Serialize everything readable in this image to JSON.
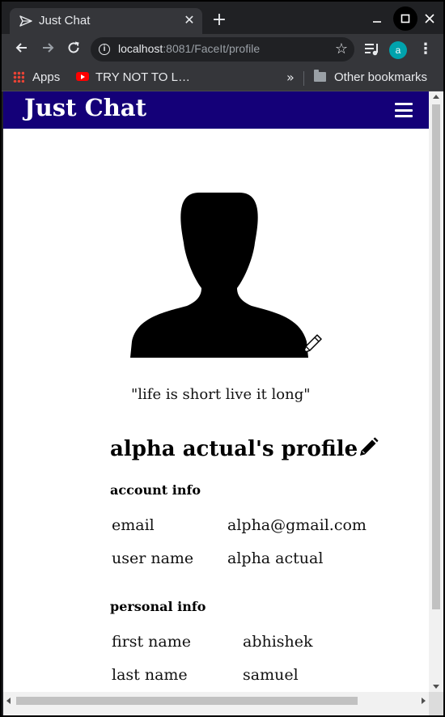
{
  "browser": {
    "tab_title": "Just Chat",
    "tab_close": "✕",
    "new_tab": "+",
    "url_host": "localhost",
    "url_path": ":8081/FaceIt/profile",
    "profile_initial": "a",
    "icons": {
      "tab": "send-arrow-icon",
      "back": "arrow-left-icon",
      "forward": "arrow-right-icon",
      "reload": "reload-icon",
      "info": "info-icon",
      "star": "star-icon",
      "media": "media-queue-icon",
      "menu": "three-dots-icon",
      "folder": "folder-icon"
    },
    "accent": "#00a3ad"
  },
  "bookmarks": {
    "apps": "Apps",
    "youtube": "TRY NOT TO L…",
    "overflow": "»",
    "other": "Other bookmarks"
  },
  "app": {
    "brand": "Just Chat",
    "navbar_color": "#140078"
  },
  "profile": {
    "status_quote": "\"life is short live it long\"",
    "title": "alpha actual's profile",
    "account": {
      "heading": "account info",
      "rows": [
        {
          "label": "email",
          "value": "alpha@gmail.com"
        },
        {
          "label": "user name",
          "value": "alpha actual"
        }
      ]
    },
    "personal": {
      "heading": "personal info",
      "rows": [
        {
          "label": "first name",
          "value": "abhishek"
        },
        {
          "label": "last name",
          "value": "samuel"
        }
      ]
    }
  }
}
